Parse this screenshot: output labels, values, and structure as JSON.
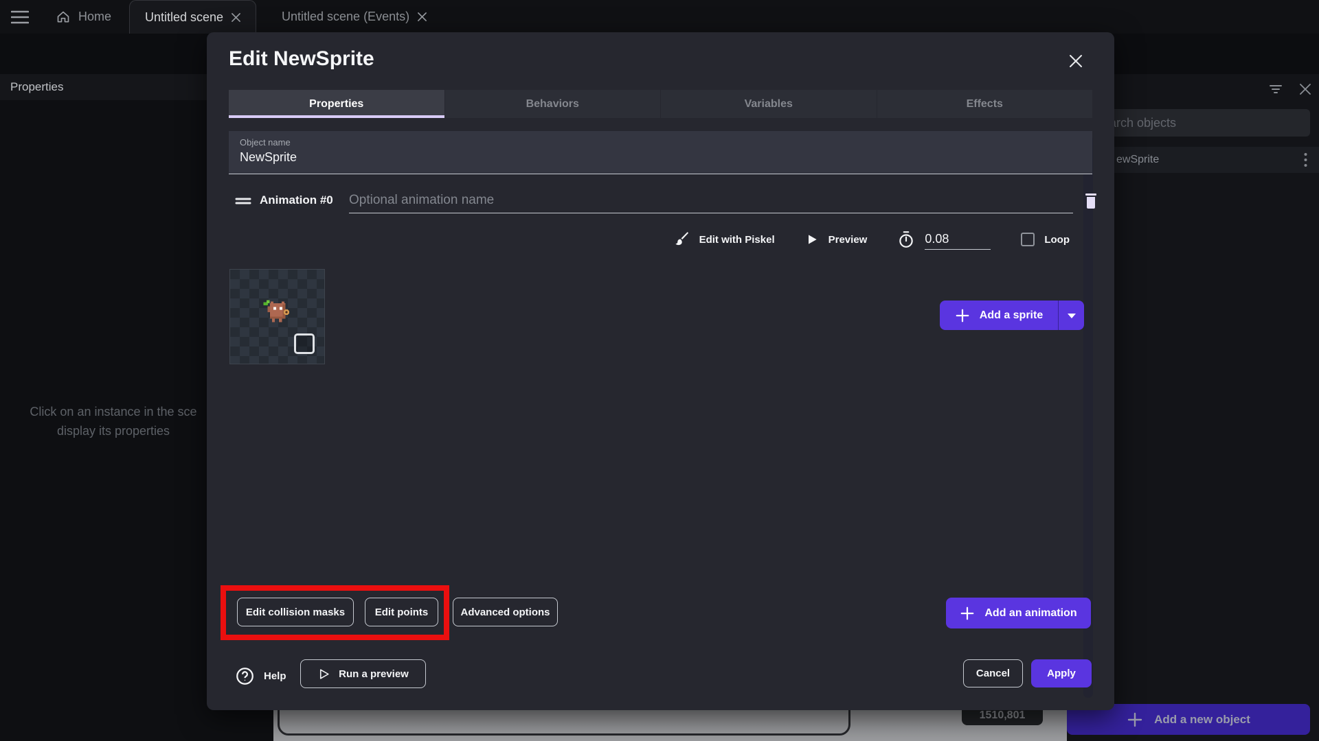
{
  "app": {
    "tabs": [
      {
        "label": "Home"
      },
      {
        "label": "Untitled scene"
      },
      {
        "label": "Untitled scene (Events)"
      }
    ],
    "left_panel": {
      "title": "Properties",
      "empty_line1": "Click on an instance in the sce",
      "empty_line2": "display its properties"
    },
    "right_panel": {
      "search_placeholder": "earch objects",
      "object_item": "ewSprite",
      "add_object_label": "Add a new object"
    },
    "canvas_badge": "1510,801"
  },
  "dialog": {
    "title": "Edit NewSprite",
    "tabs": [
      "Properties",
      "Behaviors",
      "Variables",
      "Effects"
    ],
    "active_tab": "Properties",
    "object_name_label": "Object name",
    "object_name_value": "NewSprite",
    "animation": {
      "label": "Animation #0",
      "name_placeholder": "Optional animation name"
    },
    "controls": {
      "edit_with_piskel": "Edit with Piskel",
      "preview": "Preview",
      "time_between_frames": "0.08",
      "loop_label": "Loop"
    },
    "add_sprite_label": "Add a sprite",
    "buttons": {
      "edit_collision_masks": "Edit collision masks",
      "edit_points": "Edit points",
      "advanced_options": "Advanced options",
      "add_animation": "Add an animation",
      "help": "Help",
      "run_preview": "Run a preview",
      "cancel": "Cancel",
      "apply": "Apply"
    }
  },
  "colors": {
    "accent": "#5a35e0",
    "highlight_red": "#eb0f0f",
    "tab_underline": "#d8cbf6"
  }
}
